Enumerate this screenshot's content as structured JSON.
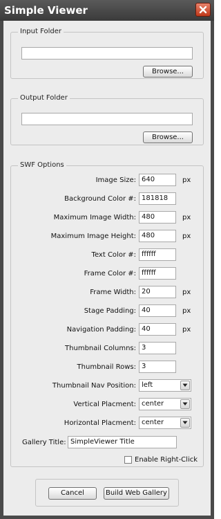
{
  "window": {
    "title": "Simple Viewer",
    "close_icon": "close-icon",
    "accent_close": "#c0391b"
  },
  "input_folder": {
    "legend": "Input Folder",
    "value": "",
    "browse_label": "Browse..."
  },
  "output_folder": {
    "legend": "Output Folder",
    "value": "",
    "browse_label": "Browse..."
  },
  "swf": {
    "legend": "SWF Options",
    "fields": [
      {
        "label": "Image Size:",
        "value": "640",
        "unit": "px"
      },
      {
        "label": "Background Color #:",
        "value": "181818",
        "unit": ""
      },
      {
        "label": "Maximum Image Width:",
        "value": "480",
        "unit": "px"
      },
      {
        "label": "Maximum Image Height:",
        "value": "480",
        "unit": "px"
      },
      {
        "label": "Text Color #:",
        "value": "ffffff",
        "unit": ""
      },
      {
        "label": "Frame Color #:",
        "value": "ffffff",
        "unit": ""
      },
      {
        "label": "Frame Width:",
        "value": "20",
        "unit": "px"
      },
      {
        "label": "Stage Padding:",
        "value": "40",
        "unit": "px"
      },
      {
        "label": "Navigation Padding:",
        "value": "40",
        "unit": "px"
      },
      {
        "label": "Thumbnail Columns:",
        "value": "3",
        "unit": ""
      },
      {
        "label": "Thumbnail Rows:",
        "value": "3",
        "unit": ""
      }
    ],
    "selects": [
      {
        "label": "Thumbnail Nav Position:",
        "value": "left"
      },
      {
        "label": "Vertical Placment:",
        "value": "center"
      },
      {
        "label": "Horizontal Placment:",
        "value": "center"
      }
    ],
    "gallery_title_label": "Gallery Title:",
    "gallery_title_value": "SimpleViewer Title",
    "enable_right_click_label": "Enable Right-Click",
    "enable_right_click_checked": false
  },
  "actions": {
    "cancel_label": "Cancel",
    "build_label": "Build Web Gallery"
  }
}
